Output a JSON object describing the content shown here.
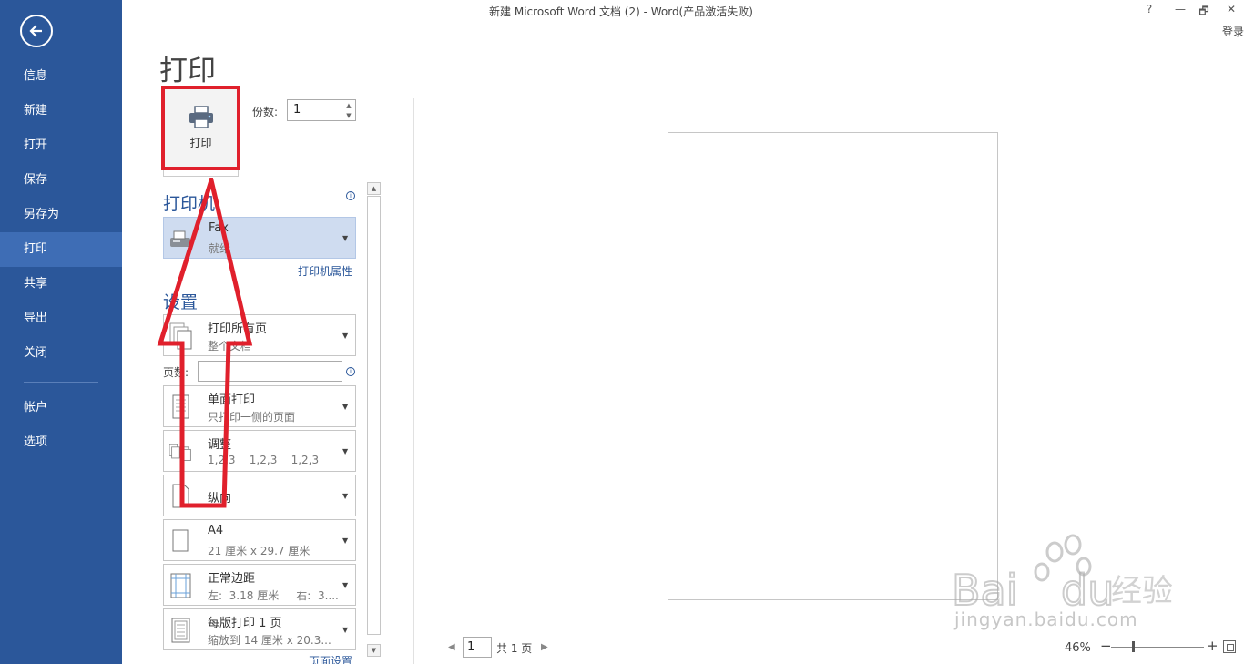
{
  "window": {
    "title": "新建 Microsoft Word 文档 (2) - Word(产品激活失败)",
    "help": "?",
    "minimize": "—",
    "restore": "🗗",
    "close": "✕",
    "login": "登录"
  },
  "sidebar": {
    "items": [
      {
        "label": "信息"
      },
      {
        "label": "新建"
      },
      {
        "label": "打开"
      },
      {
        "label": "保存"
      },
      {
        "label": "另存为"
      },
      {
        "label": "打印"
      },
      {
        "label": "共享"
      },
      {
        "label": "导出"
      },
      {
        "label": "关闭"
      },
      {
        "label": "帐户"
      },
      {
        "label": "选项"
      }
    ],
    "active": "打印",
    "color": "#2b579a"
  },
  "print": {
    "heading": "打印",
    "button_label": "打印",
    "copies_label": "份数:",
    "copies_value": "1"
  },
  "printer": {
    "section_title": "打印机",
    "name": "Fax",
    "status": "就绪",
    "properties_link": "打印机属性"
  },
  "settings": {
    "section_title": "设置",
    "range": {
      "line1": "打印所有页",
      "line2": "整个文档"
    },
    "pages_label": "页数:",
    "sides": {
      "line1": "单面打印",
      "line2": "只打印一侧的页面"
    },
    "collate": {
      "line1": "调整",
      "line2": "1,2,3    1,2,3    1,2,3"
    },
    "orientation": {
      "line1": "纵向"
    },
    "paper": {
      "line1": "A4",
      "line2": "21 厘米 x 29.7 厘米"
    },
    "margins": {
      "line1": "正常边距",
      "line2": "左:  3.18 厘米     右:  3...."
    },
    "per_sheet": {
      "line1": "每版打印 1 页",
      "line2": "缩放到 14 厘米 x 20.3..."
    },
    "page_setup_link": "页面设置"
  },
  "preview": {
    "page_input": "1",
    "total": "共 1 页",
    "zoom": "46%",
    "zoom_fraction": 0.46
  },
  "annotation": {
    "color": "#e0202c"
  },
  "watermark": {
    "brand": "Bai du 经验",
    "url": "jingyan.baidu.com"
  }
}
